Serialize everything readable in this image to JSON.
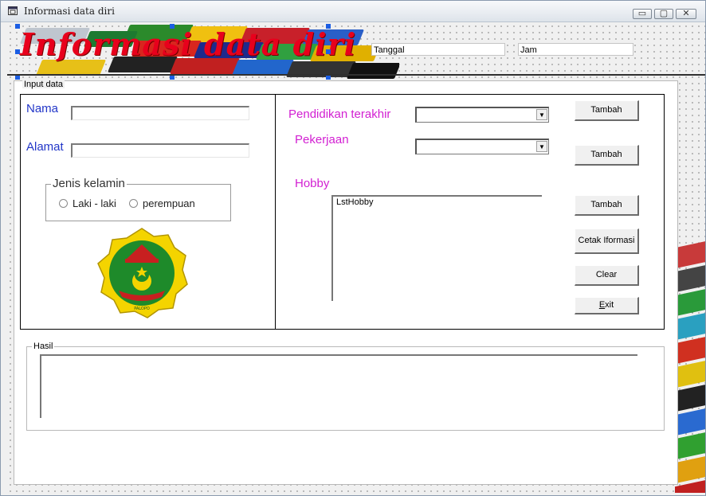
{
  "window": {
    "title": "Informasi data diri",
    "controls": {
      "minimize": "▭",
      "maximize": "▢",
      "close": "✕"
    }
  },
  "header": {
    "heading": "Informasi data diri",
    "tanggal_value": "Tanggal",
    "jam_value": "Jam"
  },
  "input_frame": {
    "legend": "Input data",
    "nama_label": "Nama",
    "nama_value": "",
    "alamat_label": "Alamat",
    "alamat_value": "",
    "gender": {
      "legend": "Jenis kelamin",
      "option_male": "Laki - laki",
      "option_female": "perempuan"
    },
    "pendidikan_label": "Pendidikan terakhir",
    "pekerjaan_label": "Pekerjaan",
    "hobby_label": "Hobby",
    "hobby_list_item": "LstHobby",
    "buttons": {
      "tambah1": "Tambah",
      "tambah2": "Tambah",
      "tambah3": "Tambah",
      "cetak": "Cetak Iformasi",
      "clear": "Clear",
      "exit_mnemonic": "E",
      "exit_rest": "xit"
    },
    "logo_caption": "PALOPO"
  },
  "hasil_frame": {
    "legend": "Hasil",
    "value": ""
  },
  "colors": {
    "heading": "#e8001c",
    "label_blue": "#2236c8",
    "label_magenta": "#d21fd2",
    "selection_handle": "#1c5ee3"
  }
}
